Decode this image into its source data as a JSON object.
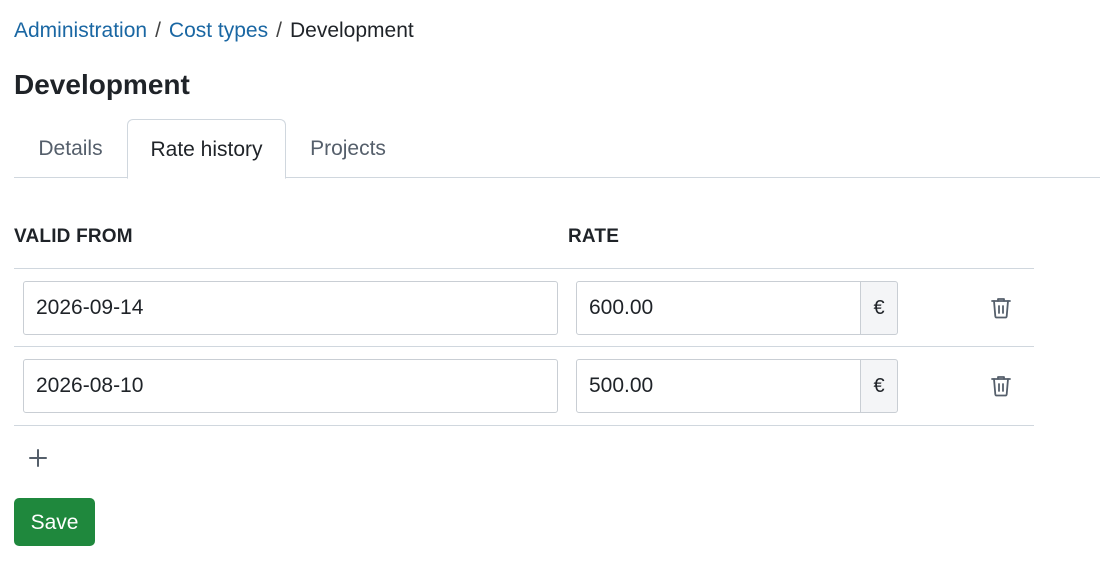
{
  "breadcrumb": {
    "items": [
      {
        "label": "Administration"
      },
      {
        "label": "Cost types"
      },
      {
        "label": "Development"
      }
    ],
    "separator": "/"
  },
  "page": {
    "title": "Development"
  },
  "tabs": [
    {
      "label": "Details",
      "active": false
    },
    {
      "label": "Rate history",
      "active": true
    },
    {
      "label": "Projects",
      "active": false
    }
  ],
  "table": {
    "headers": {
      "valid_from": "VALID FROM",
      "rate": "RATE"
    },
    "rows": [
      {
        "valid_from": "2026-09-14",
        "rate": "600.00",
        "currency": "€"
      },
      {
        "valid_from": "2026-08-10",
        "rate": "500.00",
        "currency": "€"
      }
    ]
  },
  "actions": {
    "save_label": "Save"
  },
  "icons": {
    "delete": "trash-icon",
    "add": "plus-icon"
  },
  "colors": {
    "link": "#1a67a3",
    "primary": "#1f883d",
    "border": "#d0d7de"
  }
}
